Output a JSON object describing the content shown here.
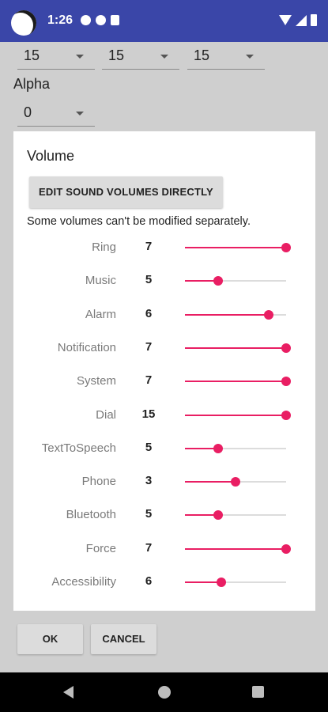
{
  "status_bar": {
    "time": "1:26"
  },
  "background": {
    "color_dropdowns": [
      "15",
      "15",
      "15"
    ],
    "alpha_label": "Alpha",
    "alpha_value": "0"
  },
  "dialog": {
    "title": "Volume",
    "edit_button": "EDIT SOUND VOLUMES DIRECTLY",
    "note": "Some volumes can't be modified separately.",
    "rows": [
      {
        "label": "Ring",
        "value": "7",
        "level": 1.0
      },
      {
        "label": "Music",
        "value": "5",
        "level": 0.33
      },
      {
        "label": "Alarm",
        "value": "6",
        "level": 0.83
      },
      {
        "label": "Notification",
        "value": "7",
        "level": 1.0
      },
      {
        "label": "System",
        "value": "7",
        "level": 1.0
      },
      {
        "label": "Dial",
        "value": "15",
        "level": 1.0
      },
      {
        "label": "TextToSpeech",
        "value": "5",
        "level": 0.33
      },
      {
        "label": "Phone",
        "value": "3",
        "level": 0.5
      },
      {
        "label": "Bluetooth",
        "value": "5",
        "level": 0.33
      },
      {
        "label": "Force",
        "value": "7",
        "level": 1.0
      },
      {
        "label": "Accessibility",
        "value": "6",
        "level": 0.36
      }
    ]
  },
  "buttons": {
    "ok": "OK",
    "cancel": "CANCEL"
  },
  "colors": {
    "accent": "#e91e63",
    "status_bar": "#3a46a8"
  },
  "icons": [
    "avatar-icon",
    "status-icon",
    "wifi-icon",
    "cell-signal-icon",
    "battery-icon",
    "back-icon",
    "home-icon",
    "recents-icon",
    "chevron-down-icon"
  ]
}
